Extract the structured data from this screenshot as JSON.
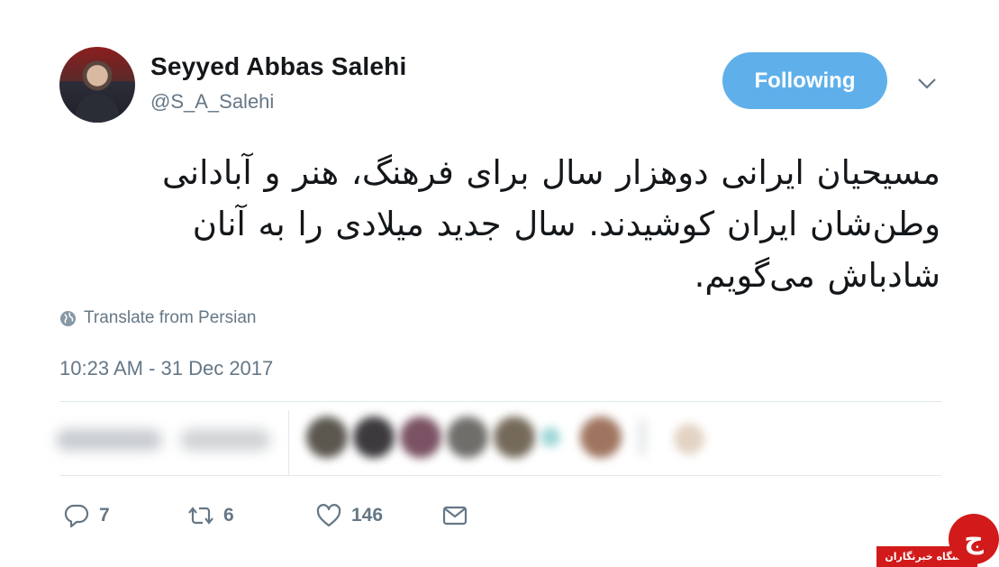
{
  "profile": {
    "name": "Seyyed Abbas Salehi",
    "handle": "@S_A_Salehi",
    "follow_label": "Following"
  },
  "tweet": {
    "lines": [
      "مسیحیان ایرانی دوهزار سال برای فرهنگ، هنر و آبادانی",
      "وطن‌شان ایران کوشیدند. سال جدید میلادی را به آنان",
      "شادباش می‌گویم."
    ],
    "translate_label": "Translate from Persian",
    "timestamp": "10:23 AM - 31 Dec 2017"
  },
  "actions": {
    "replies": "7",
    "retweets": "6",
    "likes": "146"
  },
  "icons": [
    "chevron-down-icon",
    "globe-icon",
    "reply-icon",
    "retweet-icon",
    "heart-icon",
    "mail-icon"
  ],
  "colors": {
    "follow_button": "#5fb0ea",
    "secondary_text": "#657786",
    "watermark_red": "#d21a1a"
  },
  "watermark": {
    "text": "باشگاه خبرنگاران"
  }
}
